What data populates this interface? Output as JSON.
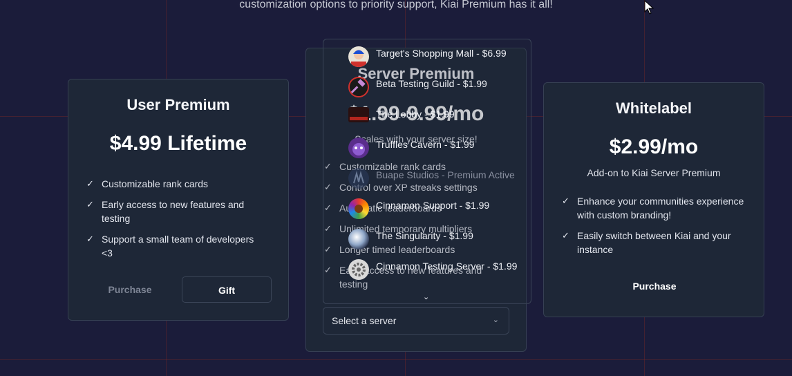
{
  "tagline": "customization options to priority support, Kiai Premium has it all!",
  "user_premium": {
    "title": "User Premium",
    "price": "$4.99 Lifetime",
    "features": [
      "Customizable rank cards",
      "Early access to new features and testing",
      "Support a small team of developers <3"
    ],
    "purchase_label": "Purchase",
    "gift_label": "Gift"
  },
  "server_premium": {
    "title": "Server Premium",
    "price": "$1.99-9.99/mo",
    "subtitle": "Scales with your server size!",
    "features": [
      "Customizable rank cards",
      "Control over XP streaks settings",
      "Automatic leaderboards",
      "Unlimited temporary multipliers",
      "Longer timed leaderboards",
      "Early access to new features and testing"
    ],
    "select_label": "Select a server"
  },
  "server_dropdown": {
    "options": [
      {
        "label": "Target's Shopping Mall - $6.99",
        "icon": "avatar-person-icon"
      },
      {
        "label": "Beta Testing Guild - $1.99",
        "icon": "avatar-hammer-icon"
      },
      {
        "label": "The Lobby - $1.99",
        "icon": "avatar-red-text-icon"
      },
      {
        "label": "Truffles Cavern - $1.99",
        "icon": "avatar-purple-creature-icon"
      },
      {
        "label": "Buape Studios - Premium Active",
        "icon": "avatar-studio-icon",
        "active": true
      },
      {
        "label": "Cinnamon Support - $1.99",
        "icon": "avatar-rainbow-icon"
      },
      {
        "label": "The Singularity - $1.99",
        "icon": "avatar-orb-icon"
      },
      {
        "label": "Cinnamon Testing Server - $1.99",
        "icon": "avatar-gear-icon"
      }
    ]
  },
  "whitelabel": {
    "title": "Whitelabel",
    "price": "$2.99/mo",
    "subtitle": "Add-on to Kiai Server Premium",
    "features": [
      "Enhance your communities experience with custom branding!",
      "Easily switch between Kiai and your instance"
    ],
    "purchase_label": "Purchase"
  },
  "colors": {
    "background": "#1b1c3a",
    "card": "#1e2737",
    "border": "#364053",
    "grid_line": "#782828"
  }
}
